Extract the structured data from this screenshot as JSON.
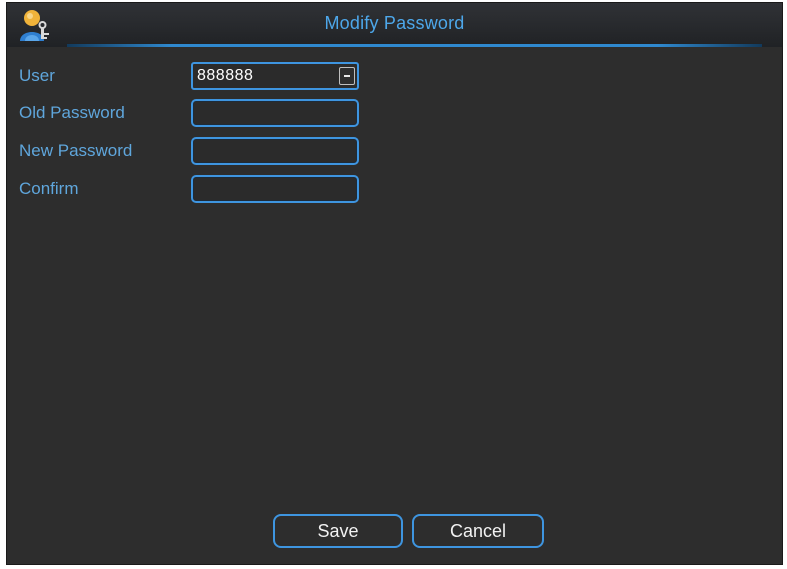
{
  "window": {
    "title": "Modify Password",
    "icon": "user-key-icon"
  },
  "form": {
    "user": {
      "label": "User",
      "value": "888888"
    },
    "old_password": {
      "label": "Old Password",
      "value": ""
    },
    "new_password": {
      "label": "New Password",
      "value": ""
    },
    "confirm": {
      "label": "Confirm",
      "value": ""
    }
  },
  "buttons": {
    "save": "Save",
    "cancel": "Cancel"
  },
  "colors": {
    "accent": "#3e95e0",
    "label": "#5fa6dc",
    "background": "#2d2d2d"
  }
}
